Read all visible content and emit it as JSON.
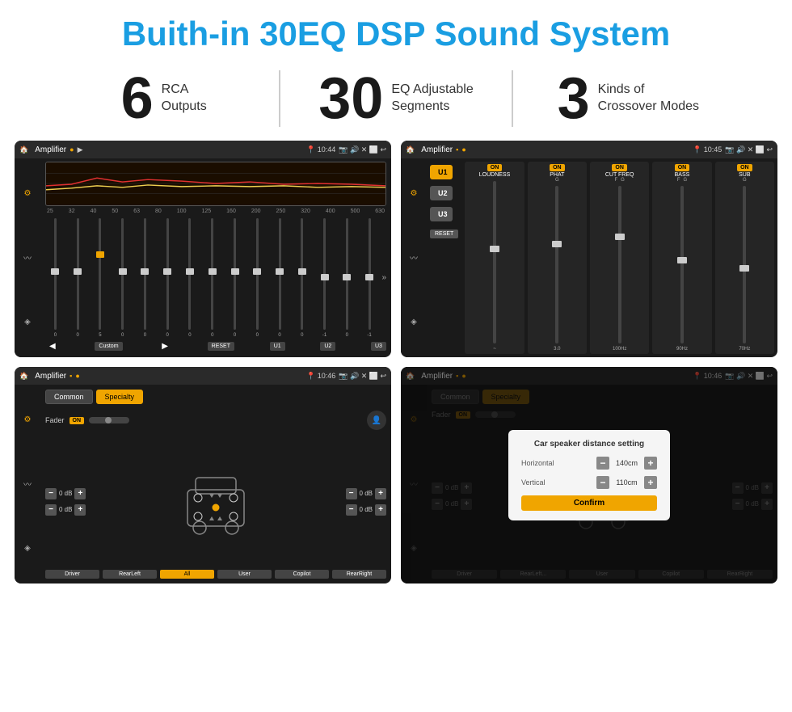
{
  "page": {
    "title": "Buith-in 30EQ DSP Sound System",
    "stats": [
      {
        "number": "6",
        "text": "RCA\nOutputs"
      },
      {
        "number": "30",
        "text": "EQ Adjustable\nSegments"
      },
      {
        "number": "3",
        "text": "Kinds of\nCrossover Modes"
      }
    ],
    "screens": [
      {
        "id": "eq-screen",
        "statusBar": {
          "appName": "Amplifier",
          "time": "10:44"
        },
        "type": "equalizer"
      },
      {
        "id": "crossover-screen",
        "statusBar": {
          "appName": "Amplifier",
          "time": "10:45"
        },
        "type": "crossover"
      },
      {
        "id": "specialty-screen",
        "statusBar": {
          "appName": "Amplifier",
          "time": "10:46"
        },
        "type": "specialty"
      },
      {
        "id": "dialog-screen",
        "statusBar": {
          "appName": "Amplifier",
          "time": "10:46"
        },
        "type": "dialog"
      }
    ],
    "eq": {
      "frequencies": [
        "25",
        "32",
        "40",
        "50",
        "63",
        "80",
        "100",
        "125",
        "160",
        "200",
        "250",
        "320",
        "400",
        "500",
        "630"
      ],
      "presetLabel": "Custom",
      "buttons": [
        "RESET",
        "U1",
        "U2",
        "U3"
      ]
    },
    "crossover": {
      "uButtons": [
        "U1",
        "U2",
        "U3"
      ],
      "columns": [
        {
          "on": true,
          "label": "LOUDNESS"
        },
        {
          "on": true,
          "label": "PHAT"
        },
        {
          "on": true,
          "label": "CUT FREQ"
        },
        {
          "on": true,
          "label": "BASS"
        },
        {
          "on": true,
          "label": "SUB"
        }
      ],
      "resetLabel": "RESET"
    },
    "specialty": {
      "tabs": [
        "Common",
        "Specialty"
      ],
      "activeTab": "Specialty",
      "faderLabel": "Fader",
      "onLabel": "ON",
      "dbValues": [
        "0 dB",
        "0 dB",
        "0 dB",
        "0 dB"
      ],
      "bottomBtns": [
        "Driver",
        "RearLeft",
        "All",
        "User",
        "Copilot",
        "RearRight"
      ]
    },
    "dialog": {
      "title": "Car speaker distance setting",
      "horizontal": {
        "label": "Horizontal",
        "value": "140cm"
      },
      "vertical": {
        "label": "Vertical",
        "value": "110cm"
      },
      "confirmLabel": "Confirm",
      "dbRight1": "0 dB",
      "dbRight2": "0 dB"
    }
  }
}
